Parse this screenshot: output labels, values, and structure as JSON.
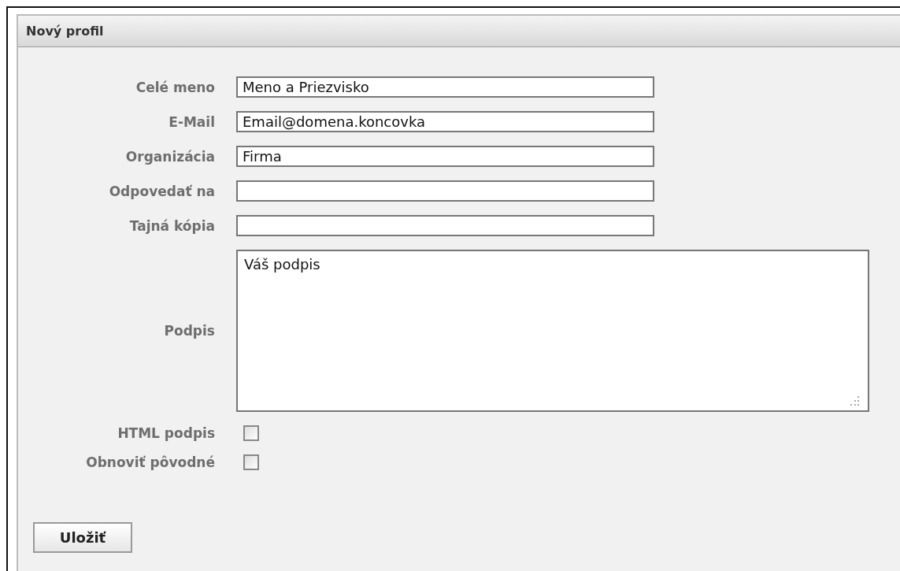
{
  "panel": {
    "title": "Nový profil",
    "fields": [
      {
        "kind": "text",
        "label": "Celé meno",
        "value": "Meno a Priezvisko"
      },
      {
        "kind": "text",
        "label": "E-Mail",
        "value": "Email@domena.koncovka"
      },
      {
        "kind": "text",
        "label": "Organizácia",
        "value": "Firma"
      },
      {
        "kind": "text",
        "label": "Odpovedať na"
      },
      {
        "kind": "text",
        "label": "Tajná kópia"
      },
      {
        "kind": "textarea",
        "label": "Podpis",
        "value": "Váš podpis"
      },
      {
        "kind": "checkbox",
        "label": "HTML podpis",
        "checked": false
      },
      {
        "kind": "checkbox",
        "label": "Obnoviť pôvodné",
        "checked": false
      }
    ],
    "save_button": "Uložiť"
  }
}
